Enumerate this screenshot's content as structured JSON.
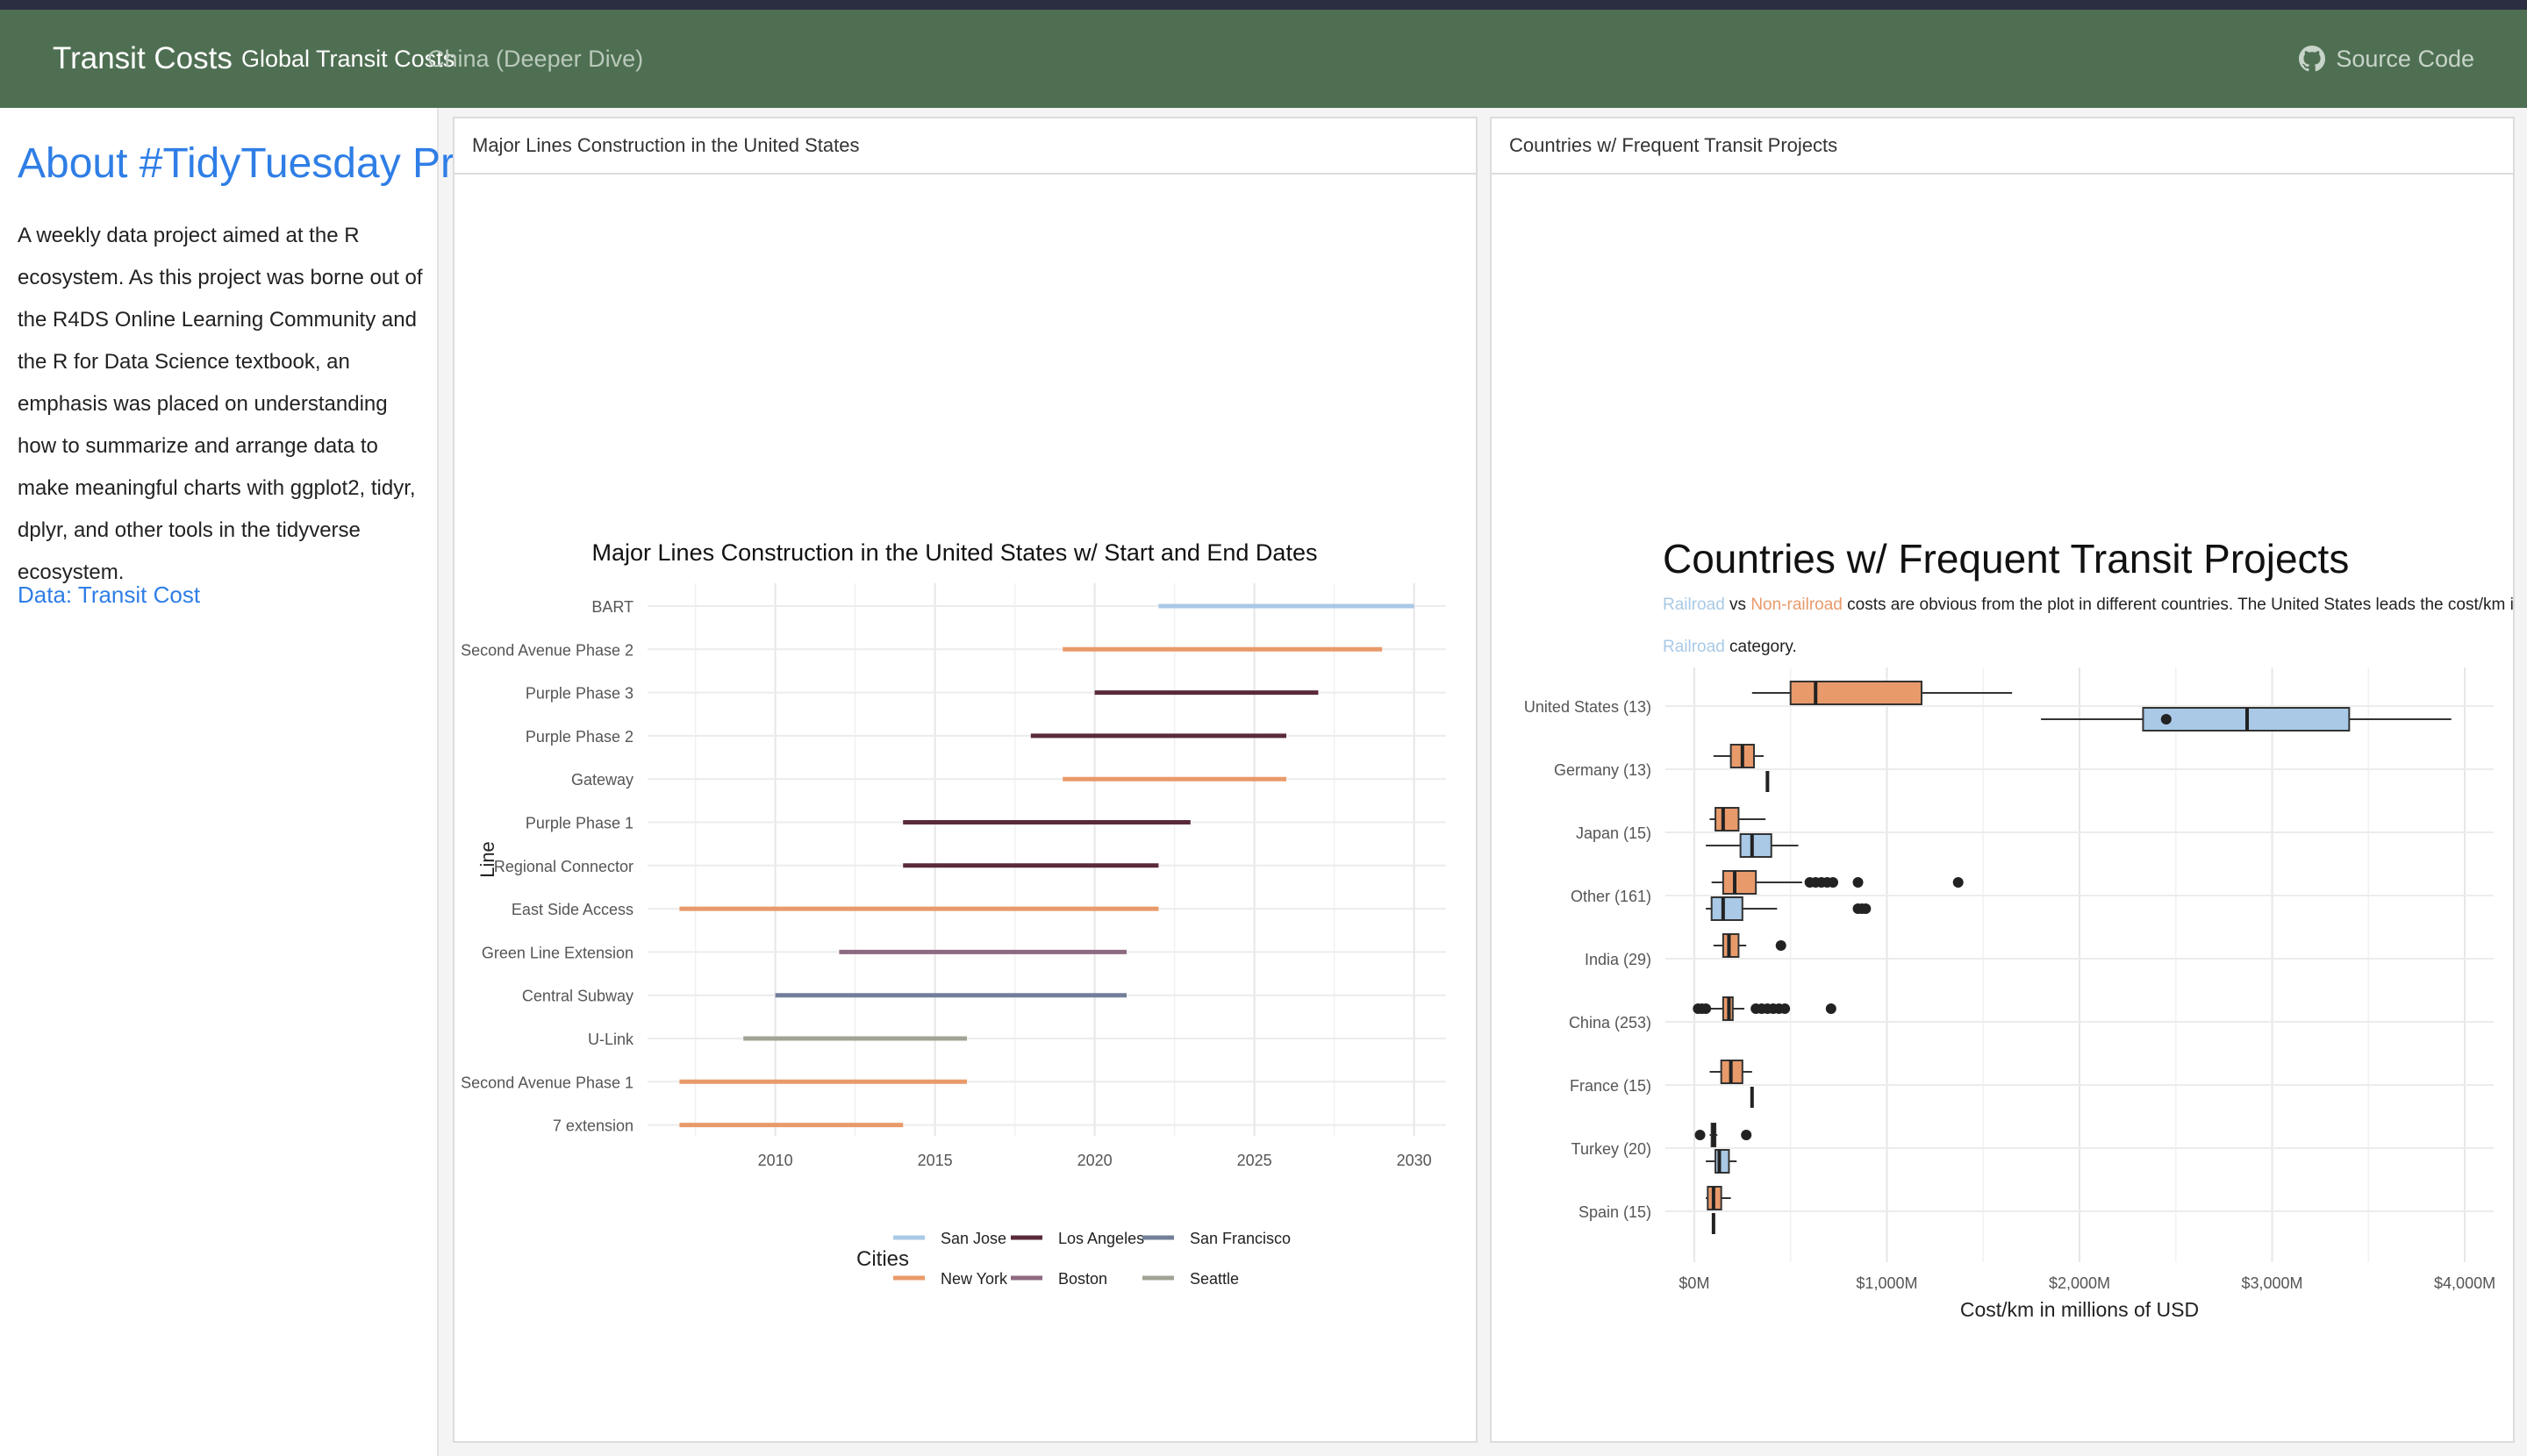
{
  "navbar": {
    "brand": "Transit Costs",
    "tabs": [
      {
        "label": "Global Transit Costs",
        "active": true
      },
      {
        "label": "China (Deeper Dive)",
        "active": false
      }
    ],
    "source_label": "Source Code",
    "source_icon": "github-icon",
    "bg_color": "#4f6f52"
  },
  "sidebar": {
    "title": "About #TidyTuesday Project",
    "text": "A weekly data project aimed at the R ecosystem. As this project was borne out of the R4DS Online Learning Community and the R for Data Science textbook, an emphasis was placed on understanding how to summarize and arrange data to make meaningful charts with ggplot2, tidyr, dplyr, and other tools in the tidyverse ecosystem.",
    "link": "Data: Transit Cost"
  },
  "cards": {
    "left_title": "Major Lines Construction in the United States",
    "right_title": "Countries w/ Frequent Transit Projects"
  },
  "chart_data": [
    {
      "type": "gantt",
      "title": "Major Lines Construction in the United States w/ Start and End Dates",
      "xlabel": "",
      "ylabel": "Line",
      "xlim": [
        2006,
        2031
      ],
      "xticks": [
        2010,
        2015,
        2020,
        2025,
        2030
      ],
      "grid": true,
      "legend_title": "Cities",
      "legend_position": "bottom",
      "cities": [
        {
          "name": "San Jose",
          "color": "#a9c9e6"
        },
        {
          "name": "Los Angeles",
          "color": "#5a2a3a"
        },
        {
          "name": "San Francisco",
          "color": "#727f99"
        },
        {
          "name": "New York",
          "color": "#e99a6a"
        },
        {
          "name": "Boston",
          "color": "#8e6a80"
        },
        {
          "name": "Seattle",
          "color": "#a3a395"
        }
      ],
      "lines": [
        {
          "name": "BART",
          "city": "San Jose",
          "start": 2022,
          "end": 2030
        },
        {
          "name": "Second Avenue Phase 2",
          "city": "New York",
          "start": 2019,
          "end": 2029
        },
        {
          "name": "Purple Phase 3",
          "city": "Los Angeles",
          "start": 2020,
          "end": 2027
        },
        {
          "name": "Purple Phase 2",
          "city": "Los Angeles",
          "start": 2018,
          "end": 2026
        },
        {
          "name": "Gateway",
          "city": "New York",
          "start": 2019,
          "end": 2026
        },
        {
          "name": "Purple Phase 1",
          "city": "Los Angeles",
          "start": 2014,
          "end": 2023
        },
        {
          "name": "Regional Connector",
          "city": "Los Angeles",
          "start": 2014,
          "end": 2022
        },
        {
          "name": "East Side Access",
          "city": "New York",
          "start": 2007,
          "end": 2022
        },
        {
          "name": "Green Line Extension",
          "city": "Boston",
          "start": 2012,
          "end": 2021
        },
        {
          "name": "Central Subway",
          "city": "San Francisco",
          "start": 2010,
          "end": 2021
        },
        {
          "name": "U-Link",
          "city": "Seattle",
          "start": 2009,
          "end": 2016
        },
        {
          "name": "Second Avenue Phase 1",
          "city": "New York",
          "start": 2007,
          "end": 2016
        },
        {
          "name": "7 extension",
          "city": "New York",
          "start": 2007,
          "end": 2014
        }
      ]
    },
    {
      "type": "boxplot",
      "title": "Countries w/ Frequent Transit Projects",
      "subtitle_parts": [
        {
          "text": "Railroad",
          "color": "#a9c9e6"
        },
        {
          "text": " vs ",
          "color": "#222222"
        },
        {
          "text": "Non-railroad",
          "color": "#e99a6a"
        },
        {
          "text": " costs are obvious from the plot in different countries. The United States leads the cost/km in",
          "color": "#222222"
        }
      ],
      "subtitle_line2_parts": [
        {
          "text": "Railroad",
          "color": "#a9c9e6"
        },
        {
          "text": " category.",
          "color": "#222222"
        }
      ],
      "xlabel": "Cost/km in millions of USD",
      "xlim": [
        -150,
        4150
      ],
      "xticks": [
        0,
        1000,
        2000,
        3000,
        4000
      ],
      "xtick_labels": [
        "$0M",
        "$1,000M",
        "$2,000M",
        "$3,000M",
        "$4,000M"
      ],
      "grid": true,
      "colors": {
        "non_railroad": "#e99a6a",
        "railroad": "#a9c9e6"
      },
      "countries": [
        {
          "label": "United States (13)",
          "non_railroad": {
            "min": 300,
            "q1": 500,
            "median": 630,
            "q3": 1180,
            "max": 1650,
            "outliers": []
          },
          "railroad": {
            "min": 1800,
            "q1": 2330,
            "median": 2870,
            "q3": 3400,
            "max": 3930,
            "outliers": [
              2450
            ]
          }
        },
        {
          "label": "Germany (13)",
          "non_railroad": {
            "min": 100,
            "q1": 190,
            "median": 250,
            "q3": 310,
            "max": 360,
            "outliers": []
          },
          "railroad": null,
          "extra_points": [
            {
              "value": 380,
              "offset": "railroad"
            }
          ]
        },
        {
          "label": "Japan (15)",
          "non_railroad": {
            "min": 80,
            "q1": 110,
            "median": 150,
            "q3": 230,
            "max": 370,
            "outliers": []
          },
          "railroad": {
            "min": 60,
            "q1": 240,
            "median": 300,
            "q3": 400,
            "max": 540,
            "outliers": []
          }
        },
        {
          "label": "Other (161)",
          "non_railroad": {
            "min": 90,
            "q1": 150,
            "median": 210,
            "q3": 320,
            "max": 560,
            "outliers": [
              600,
              630,
              660,
              690,
              720,
              850,
              1370
            ]
          },
          "railroad": {
            "min": 60,
            "q1": 90,
            "median": 150,
            "q3": 250,
            "max": 430,
            "outliers": [
              850,
              870,
              890
            ]
          }
        },
        {
          "label": "India (29)",
          "non_railroad": {
            "min": 100,
            "q1": 150,
            "median": 180,
            "q3": 230,
            "max": 270,
            "outliers": [
              450
            ]
          },
          "railroad": null
        },
        {
          "label": "China (253)",
          "non_railroad": {
            "min": 80,
            "q1": 150,
            "median": 180,
            "q3": 200,
            "max": 260,
            "outliers": [
              20,
              40,
              60,
              320,
              350,
              380,
              410,
              440,
              470,
              710
            ]
          },
          "railroad": null
        },
        {
          "label": "France (15)",
          "non_railroad": {
            "min": 80,
            "q1": 140,
            "median": 190,
            "q3": 250,
            "max": 300,
            "outliers": []
          },
          "railroad": null,
          "extra_points": [
            {
              "value": 300,
              "offset": "railroad"
            }
          ]
        },
        {
          "label": "Turkey (20)",
          "non_railroad": {
            "min": 80,
            "q1": 90,
            "median": 100,
            "q3": 110,
            "max": 120,
            "outliers": [
              30,
              270
            ]
          },
          "railroad": {
            "min": 60,
            "q1": 110,
            "median": 130,
            "q3": 180,
            "max": 220,
            "outliers": []
          }
        },
        {
          "label": "Spain (15)",
          "non_railroad": {
            "min": 60,
            "q1": 70,
            "median": 100,
            "q3": 140,
            "max": 190,
            "outliers": []
          },
          "railroad": null,
          "extra_points": [
            {
              "value": 100,
              "offset": "railroad"
            }
          ]
        }
      ]
    }
  ]
}
